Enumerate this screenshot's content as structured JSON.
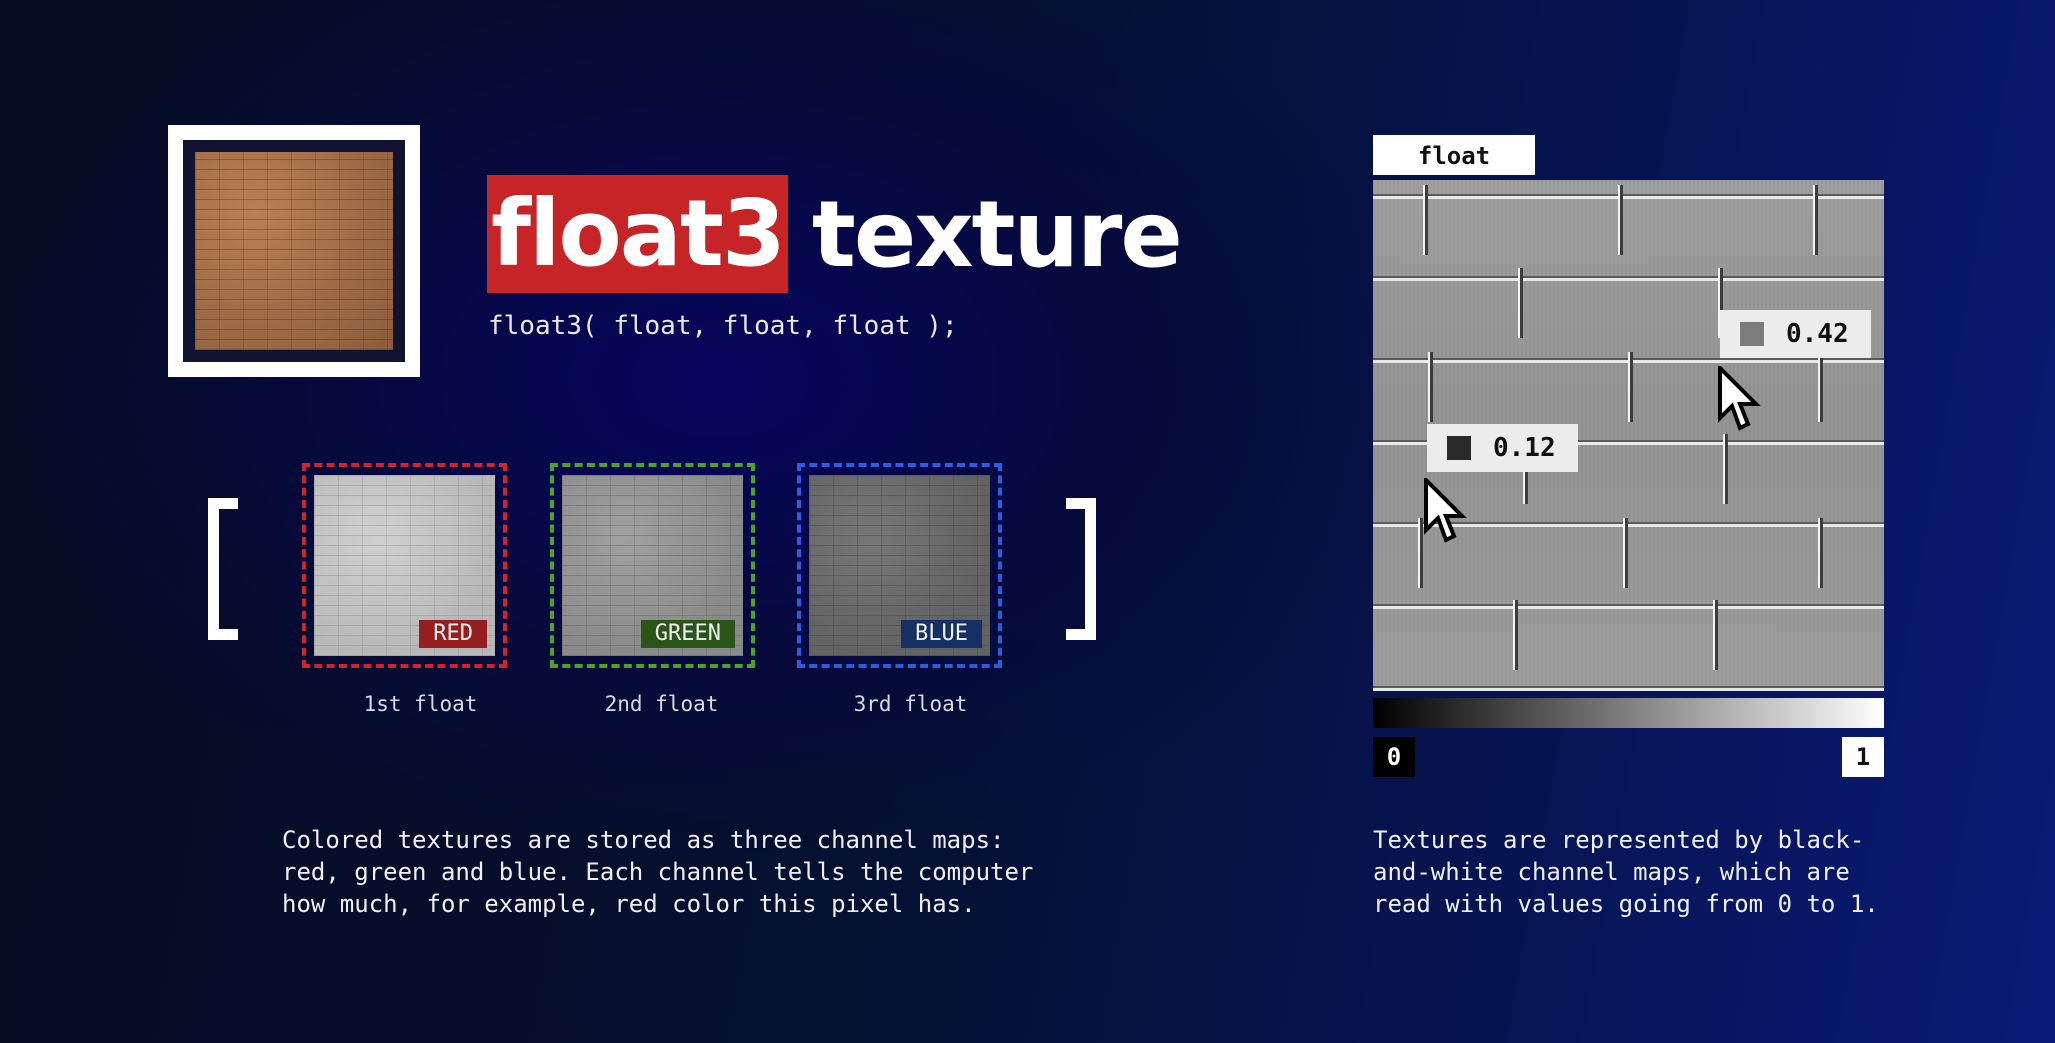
{
  "title": {
    "highlight": "float3",
    "rest": "texture"
  },
  "subtitle": "float3( float, float, float );",
  "channels": [
    {
      "tag": "RED",
      "caption": "1st float"
    },
    {
      "tag": "GREEN",
      "caption": "2nd float"
    },
    {
      "tag": "BLUE",
      "caption": "3rd float"
    }
  ],
  "description_left": "Colored textures are stored as three channel maps: red, green and blue. Each channel tells the computer how much, for example, red color this pixel has.",
  "panel": {
    "tab": "float",
    "readouts": [
      "0.42",
      "0.12"
    ],
    "scale_min": "0",
    "scale_max": "1"
  },
  "description_right": "Textures are represented by black-and-white channel maps, which are read with values going from 0 to 1.",
  "colors": {
    "red": "#d0242a",
    "green": "#4ba32a",
    "blue": "#2a5de0",
    "title_highlight": "#c62427"
  }
}
